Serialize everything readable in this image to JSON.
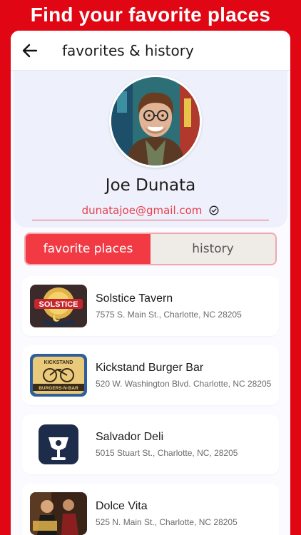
{
  "banner": {
    "headline": "Find your favorite places"
  },
  "header": {
    "title": "favorites & history",
    "back_icon": "arrow-left-icon"
  },
  "profile": {
    "name": "Joe Dunata",
    "email": "dunatajoe@gmail.com",
    "verified_icon": "check-circle-icon"
  },
  "tabs": [
    {
      "label": "favorite places",
      "active": true
    },
    {
      "label": "history",
      "active": false
    }
  ],
  "places": [
    {
      "name": "Solstice Tavern",
      "address": "7575 S. Main St., Charlotte, NC 28205"
    },
    {
      "name": "Kickstand Burger Bar",
      "address": "520 W. Washington Blvd. Charlotte, NC 28205"
    },
    {
      "name": "Salvador Deli",
      "address": "5015 Stuart St., Charlotte, NC, 28205"
    },
    {
      "name": "Dolce Vita",
      "address": "525 N. Main St., Charlotte, NC 28205"
    }
  ],
  "logo_text": {
    "solstice": "SOLSTICE",
    "kickstand": "KICKSTAND",
    "kickstand_sub": "BURGERS·N·BAR"
  },
  "colors": {
    "brand_red": "#e10613",
    "tab_active": "#f23a45",
    "email": "#e8404c"
  }
}
